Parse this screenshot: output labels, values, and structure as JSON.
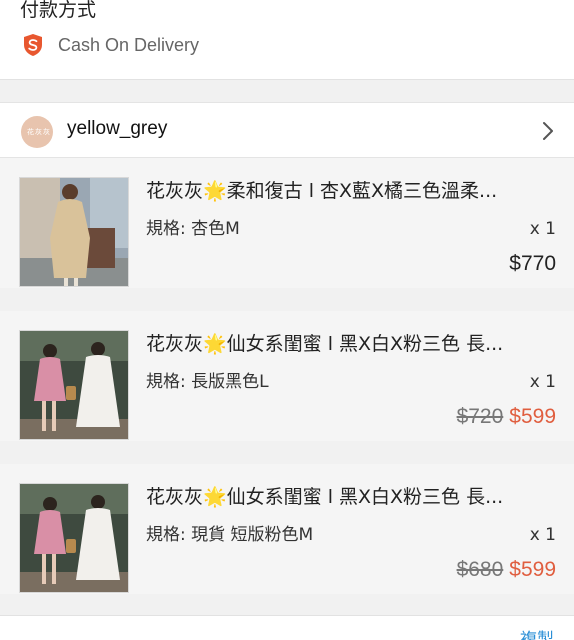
{
  "payment": {
    "section_title": "付款方式",
    "method_icon": "shield-s-icon",
    "method_label": "Cash On Delivery",
    "accent": "#e8572f"
  },
  "shop": {
    "avatar_text": "花灰灰",
    "name": "yellow_grey",
    "chevron_icon": "chevron-right-icon"
  },
  "items": [
    {
      "title": "花灰灰🌟柔和復古 l 杏X藍X橘三色溫柔...",
      "variant": "規格: 杏色M",
      "qty": "x 1",
      "price_old": "",
      "price": "$770"
    },
    {
      "title": "花灰灰🌟仙女系閨蜜 l 黑X白X粉三色 長...",
      "variant": "規格: 長版黑色L",
      "qty": "x 1",
      "price_old": "$720",
      "price": "$599"
    },
    {
      "title": "花灰灰🌟仙女系閨蜜 l 黑X白X粉三色 長...",
      "variant": "規格: 現貨 短版粉色M",
      "qty": "x 1",
      "price_old": "$680",
      "price": "$599"
    }
  ],
  "footer": {
    "copy_label": "複製"
  },
  "colors": {
    "sale_price": "#e05e3f",
    "link": "#2b8fd6"
  }
}
